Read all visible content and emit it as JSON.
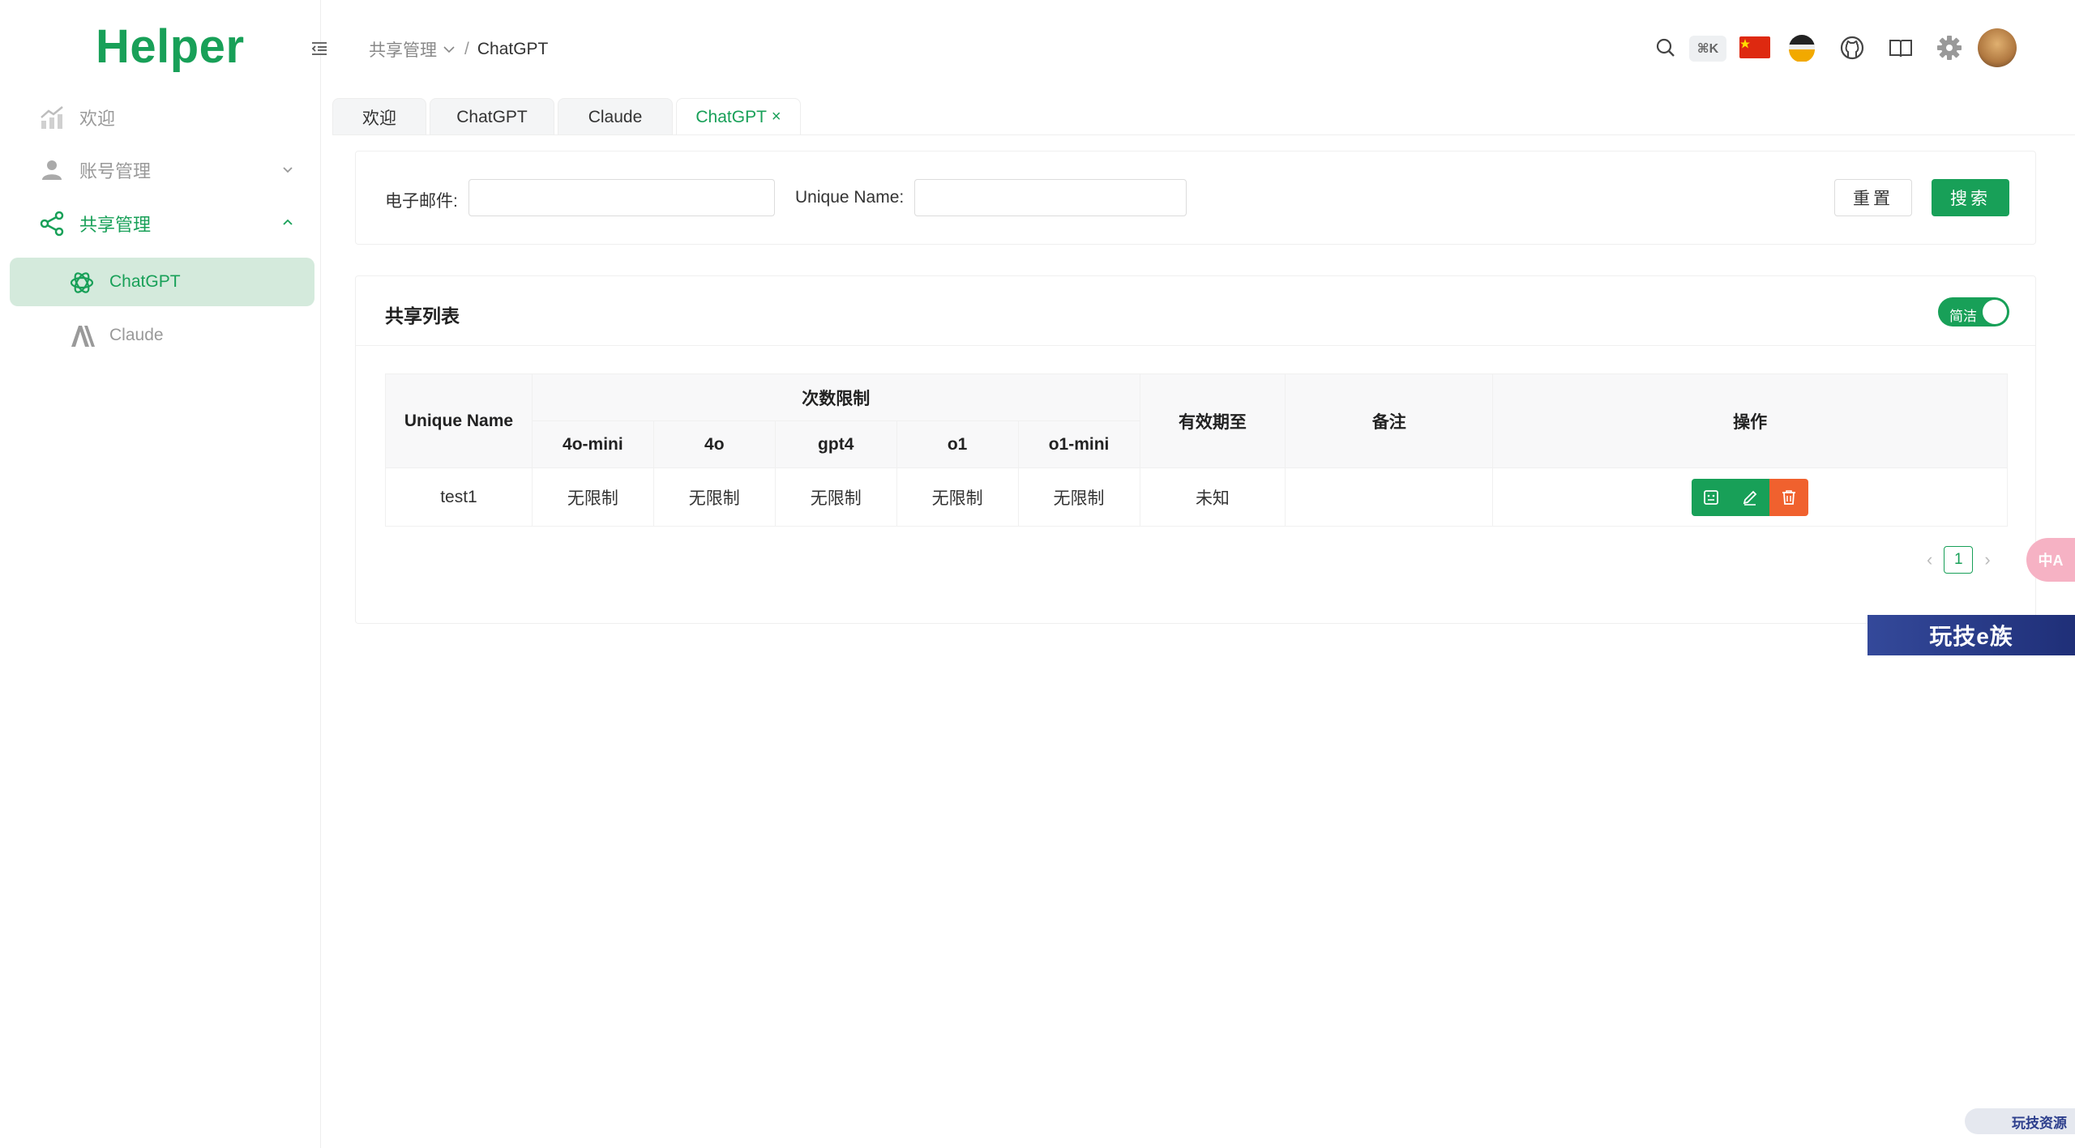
{
  "app": {
    "logo": "Helper"
  },
  "sidebar": {
    "items": [
      {
        "label": "欢迎",
        "icon": "chart-trend-icon"
      },
      {
        "label": "账号管理",
        "icon": "user-icon"
      },
      {
        "label": "共享管理",
        "icon": "share-icon"
      }
    ],
    "sub_items": [
      {
        "label": "ChatGPT",
        "icon": "openai-icon"
      },
      {
        "label": "Claude",
        "icon": "anthropic-icon"
      }
    ]
  },
  "header": {
    "breadcrumb": {
      "parent": "共享管理",
      "separator": "/",
      "current": "ChatGPT"
    },
    "shortcut": "⌘K"
  },
  "tabs": [
    {
      "label": "欢迎"
    },
    {
      "label": "ChatGPT"
    },
    {
      "label": "Claude"
    },
    {
      "label": "ChatGPT",
      "close": "×"
    }
  ],
  "search": {
    "email_label": "电子邮件:",
    "email_value": "",
    "uname_label": "Unique Name:",
    "uname_value": "",
    "reset_label": "重置",
    "search_label": "搜索"
  },
  "list": {
    "title": "共享列表",
    "toggle_label": "简洁",
    "headers": {
      "unique_name": "Unique Name",
      "limit_group": "次数限制",
      "limits": [
        "4o-mini",
        "4o",
        "gpt4",
        "o1",
        "o1-mini"
      ],
      "expire": "有效期至",
      "remark": "备注",
      "actions": "操作"
    },
    "rows": [
      {
        "name": "test1",
        "limits": [
          "无限制",
          "无限制",
          "无限制",
          "无限制",
          "无限制"
        ],
        "expire": "未知",
        "remark": ""
      }
    ],
    "pager": {
      "prev": "‹",
      "page": "1",
      "next": "›"
    }
  },
  "overlays": {
    "translate": "中A",
    "watermark": "玩技e族",
    "watermark2": "玩技资源"
  },
  "colors": {
    "accent": "#18a058",
    "danger": "#f0612e",
    "active_bg": "#d4eadc"
  }
}
